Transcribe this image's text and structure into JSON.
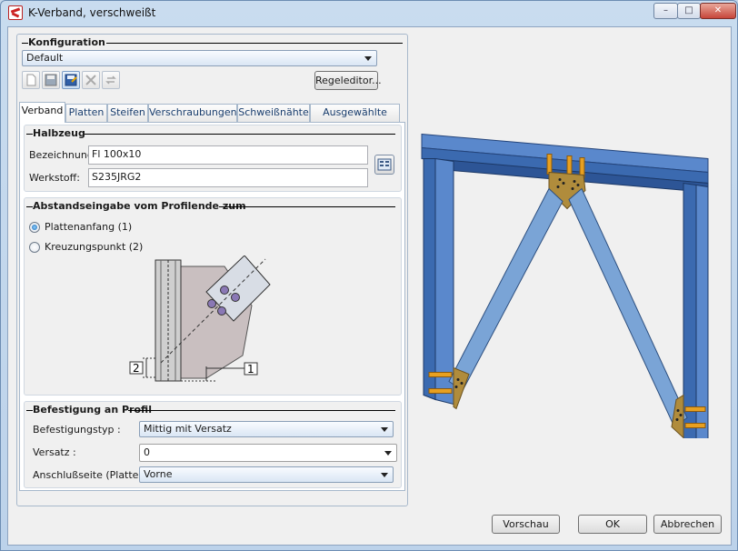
{
  "window": {
    "title": "K-Verband, verschweißt",
    "controls": {
      "minimize": "–",
      "maximize": "□",
      "close": "✕"
    }
  },
  "konfiguration": {
    "title": "Konfiguration",
    "selected": "Default",
    "rule_editor_label": "Regeleditor...",
    "toolbar_icons": [
      "new-icon",
      "save-icon",
      "save-as-icon",
      "delete-icon",
      "refresh-icon"
    ]
  },
  "tabs": [
    {
      "label": "Verband",
      "selected": true
    },
    {
      "label": "Platten"
    },
    {
      "label": "Steifen"
    },
    {
      "label": "Verschraubungen"
    },
    {
      "label": "Schweißnähte"
    },
    {
      "label": "Ausgewählte Teile"
    }
  ],
  "halbzeug": {
    "title": "Halbzeug",
    "bezeichnung_label": "Bezeichnung:",
    "bezeichnung_value": "Fl 100x10",
    "werkstoff_label": "Werkstoff:",
    "werkstoff_value": "S235JRG2"
  },
  "abstand": {
    "title": "Abstandseingabe vom Profilende zum",
    "options": [
      {
        "label": "Plattenanfang (1)",
        "checked": true
      },
      {
        "label": "Kreuzungspunkt (2)",
        "checked": false
      }
    ],
    "diagram_labels": {
      "one": "1",
      "two": "2"
    }
  },
  "befestigung": {
    "title": "Befestigung an Profil",
    "typ_label": "Befestigungstyp :",
    "typ_value": "Mittig mit Versatz",
    "versatz_label": "Versatz :",
    "versatz_value": "0",
    "seite_label": "Anschlußseite (Platte) :",
    "seite_value": "Vorne"
  },
  "buttons": {
    "preview": "Vorschau",
    "ok": "OK",
    "cancel": "Abbrechen"
  },
  "colors": {
    "steel_blue": "#3f6fbf",
    "brace_blue": "#6f9ccf",
    "plate_gold": "#b08c3c",
    "stiffener_orange": "#e8a020"
  }
}
